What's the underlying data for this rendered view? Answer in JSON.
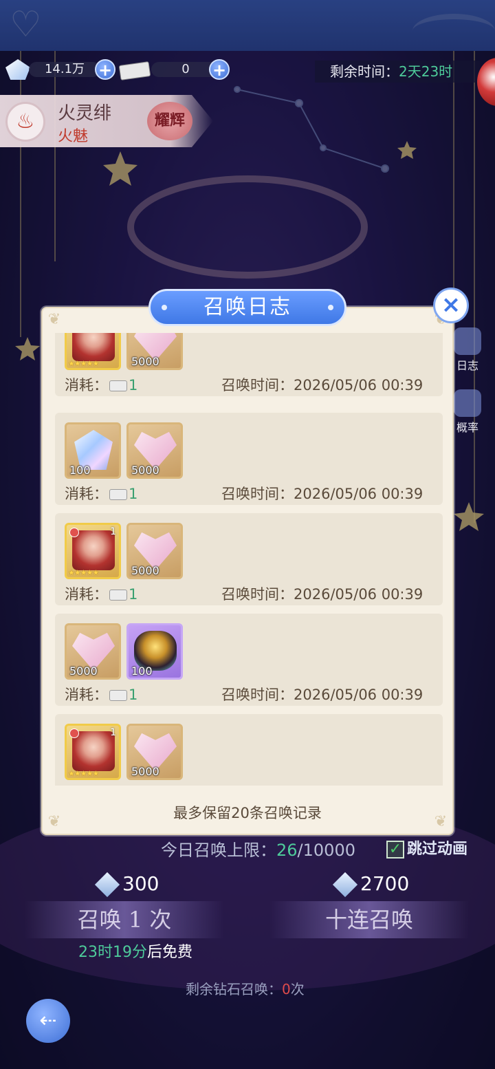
{
  "resources": {
    "gems": "14.1万",
    "tickets": "0"
  },
  "timer": {
    "label": "剩余时间：",
    "value": "2天23时"
  },
  "character": {
    "name": "火灵绯",
    "subtitle": "火魅",
    "badge": "耀辉"
  },
  "side": {
    "log_label": "日志",
    "rate_label": "概率"
  },
  "modal": {
    "title": "召唤日志",
    "close_symbol": "×",
    "consume_label": "消耗：",
    "time_label": "召唤时间：",
    "entries": [
      {
        "count": "1",
        "time": "2026/05/06 00:39",
        "items": [
          {
            "kind": "character",
            "qty": "",
            "level": "",
            "stars": "★★★★★"
          },
          {
            "kind": "exp",
            "qty": "5000"
          }
        ]
      },
      {
        "count": "1",
        "time": "2026/05/06 00:39",
        "items": [
          {
            "kind": "gem",
            "qty": "100"
          },
          {
            "kind": "exp",
            "qty": "5000"
          }
        ]
      },
      {
        "count": "1",
        "time": "2026/05/06 00:39",
        "items": [
          {
            "kind": "character",
            "qty": "",
            "level": "1",
            "stars": "★★★★★"
          },
          {
            "kind": "exp",
            "qty": "5000"
          }
        ]
      },
      {
        "count": "1",
        "time": "2026/05/06 00:39",
        "items": [
          {
            "kind": "exp",
            "qty": "5000"
          },
          {
            "kind": "egg",
            "qty": "100"
          }
        ]
      },
      {
        "count": "",
        "time": "",
        "items": [
          {
            "kind": "character",
            "qty": "",
            "level": "1",
            "stars": "★★★★★"
          },
          {
            "kind": "exp",
            "qty": "5000"
          }
        ]
      }
    ],
    "footer": "最多保留20条召唤记录"
  },
  "bottom": {
    "limit_label": "今日召唤上限：",
    "limit_used": "26",
    "limit_max": "/10000",
    "skip_label": "跳过动画",
    "skip_checked": "✓",
    "single_cost": "300",
    "ten_cost": "2700",
    "single_label": "召唤 1 次",
    "ten_label": "十连召唤",
    "free_time": "23时19分",
    "free_suffix": "后免费",
    "diamond_label": "剩余钻石召唤：",
    "diamond_count": "0",
    "diamond_suffix": "次"
  },
  "colors": {
    "accent_blue": "#3f78e6",
    "green": "#4ecb9a",
    "red": "#e04b4b"
  }
}
